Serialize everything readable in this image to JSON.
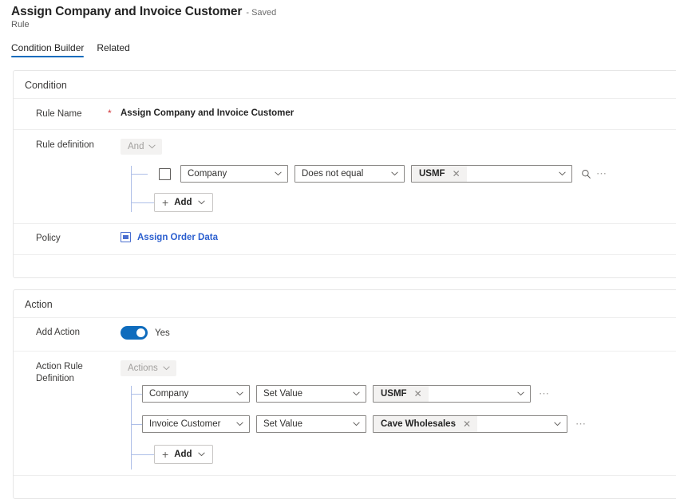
{
  "header": {
    "title": "Assign Company and Invoice Customer",
    "saved_status": "- Saved",
    "subtitle": "Rule"
  },
  "tabs": [
    {
      "label": "Condition Builder",
      "active": true
    },
    {
      "label": "Related",
      "active": false
    }
  ],
  "condition_card": {
    "title": "Condition",
    "rule_name": {
      "label": "Rule Name",
      "required_marker": "*",
      "value": "Assign Company and Invoice Customer"
    },
    "rule_definition": {
      "label": "Rule definition",
      "operator": "And",
      "rows": [
        {
          "checkbox_checked": false,
          "field": "Company",
          "operator": "Does not equal",
          "token": "USMF",
          "token_remove": "✕",
          "lookup_icon": "search-icon",
          "more_icon": "⋯"
        }
      ],
      "add_button": "Add"
    },
    "policy": {
      "label": "Policy",
      "icon": "policy-icon",
      "link_text": "Assign Order Data"
    }
  },
  "action_card": {
    "title": "Action",
    "add_action": {
      "label": "Add Action",
      "toggle_value": "Yes",
      "toggle_on": true
    },
    "action_rule_definition": {
      "label": "Action Rule Definition",
      "operator": "Actions",
      "rows": [
        {
          "field": "Company",
          "operator": "Set Value",
          "token": "USMF",
          "token_remove": "✕",
          "more_icon": "⋯"
        },
        {
          "field": "Invoice Customer",
          "operator": "Set Value",
          "token": "Cave Wholesales",
          "token_remove": "✕",
          "more_icon": "⋯"
        }
      ],
      "add_button": "Add"
    }
  },
  "colors": {
    "accent": "#0f6cbd",
    "link": "#2b5fcf",
    "tree_line": "#aebfe8",
    "required": "#d13438",
    "token_bg": "#f3f2f1"
  }
}
